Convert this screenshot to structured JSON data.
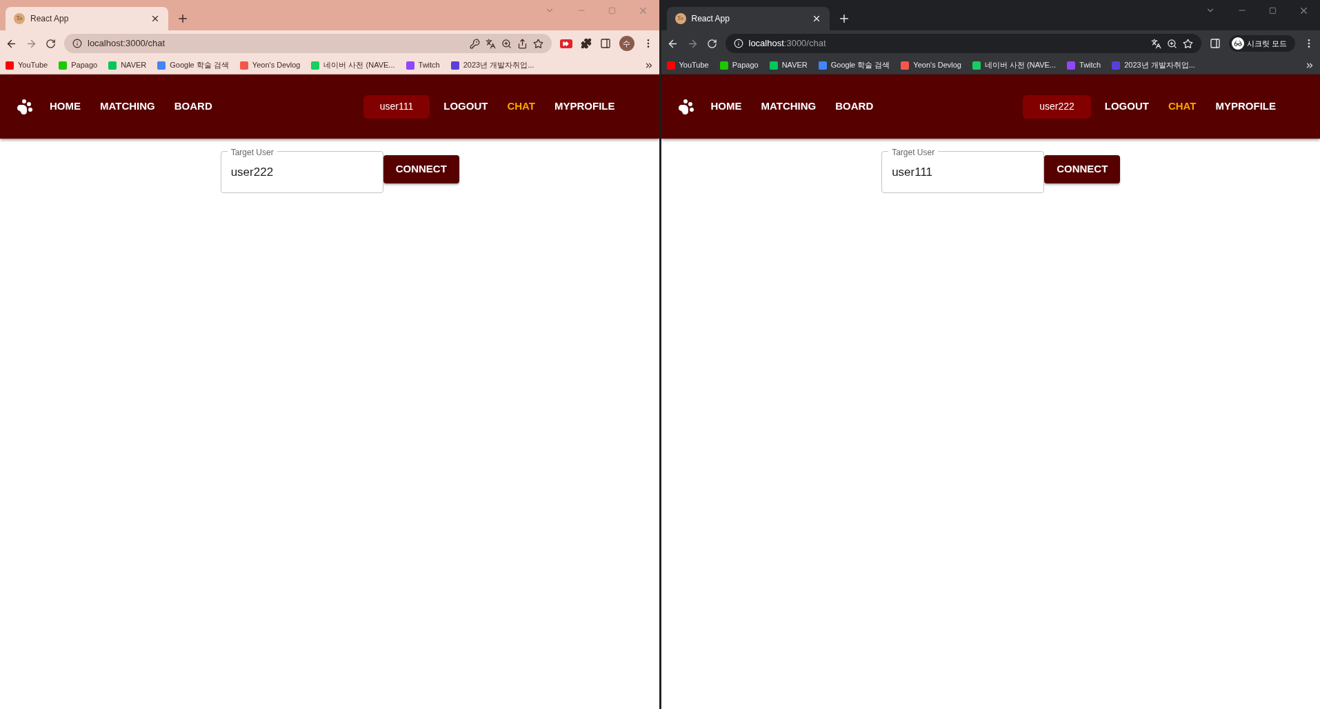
{
  "windows": [
    {
      "kind": "light",
      "tab": {
        "title": "React App",
        "favicon": "To"
      },
      "address": {
        "host": "localhost",
        "path": ":3000/chat"
      },
      "omnibox_icons": [
        {
          "kind": "key"
        },
        {
          "kind": "translate"
        },
        {
          "kind": "zoom"
        },
        {
          "kind": "share"
        },
        {
          "kind": "star"
        }
      ],
      "toolbar_icons": [
        {
          "kind": "extension"
        },
        {
          "kind": "puzzle"
        },
        {
          "kind": "sidepanel"
        }
      ],
      "profile": {
        "kind": "avatar",
        "label": "수"
      },
      "bookmarks": [
        {
          "label": "YouTube",
          "color": "#ff0000"
        },
        {
          "label": "Papago",
          "color": "#1ec800"
        },
        {
          "label": "NAVER",
          "color": "#03c75a"
        },
        {
          "label": "Google 학술 검색",
          "color": "#4285f4"
        },
        {
          "label": "Yeon's Devlog",
          "color": "#f4574a"
        },
        {
          "label": "네이버 사전 (NAVE...",
          "color": "#19ce60"
        },
        {
          "label": "Twitch",
          "color": "#9146ff"
        },
        {
          "label": "2023년 개발자취업...",
          "color": "#5b3fd9"
        }
      ],
      "nav": {
        "left": [
          "HOME",
          "MATCHING",
          "BOARD"
        ],
        "right": [
          {
            "kind": "user",
            "label": "user111",
            "selected": false
          },
          {
            "kind": "link",
            "label": "LOGOUT",
            "selected": false
          },
          {
            "kind": "link",
            "label": "CHAT",
            "selected": true
          },
          {
            "kind": "link",
            "label": "MYPROFILE",
            "selected": false
          }
        ]
      },
      "form": {
        "label": "Target User",
        "value": "user222",
        "button": "CONNECT"
      }
    },
    {
      "kind": "dark",
      "tab": {
        "title": "React App",
        "favicon": "To"
      },
      "address": {
        "host": "localhost",
        "path": ":3000/chat"
      },
      "omnibox_icons": [
        {
          "kind": "translate"
        },
        {
          "kind": "zoom"
        },
        {
          "kind": "star"
        }
      ],
      "toolbar_icons": [
        {
          "kind": "sidepanel"
        }
      ],
      "profile": {
        "kind": "incognito",
        "label": "시크릿 모드"
      },
      "bookmarks": [
        {
          "label": "YouTube",
          "color": "#ff0000"
        },
        {
          "label": "Papago",
          "color": "#1ec800"
        },
        {
          "label": "NAVER",
          "color": "#03c75a"
        },
        {
          "label": "Google 학술 검색",
          "color": "#4285f4"
        },
        {
          "label": "Yeon's Devlog",
          "color": "#f4574a"
        },
        {
          "label": "네이버 사전 (NAVE...",
          "color": "#19ce60"
        },
        {
          "label": "Twitch",
          "color": "#9146ff"
        },
        {
          "label": "2023년 개발자취업...",
          "color": "#5b3fd9"
        }
      ],
      "nav": {
        "left": [
          "HOME",
          "MATCHING",
          "BOARD"
        ],
        "right": [
          {
            "kind": "user",
            "label": "user222",
            "selected": false
          },
          {
            "kind": "link",
            "label": "LOGOUT",
            "selected": false
          },
          {
            "kind": "link",
            "label": "CHAT",
            "selected": true
          },
          {
            "kind": "link",
            "label": "MYPROFILE",
            "selected": false
          }
        ]
      },
      "form": {
        "label": "Target User",
        "value": "user111",
        "button": "CONNECT"
      }
    }
  ]
}
